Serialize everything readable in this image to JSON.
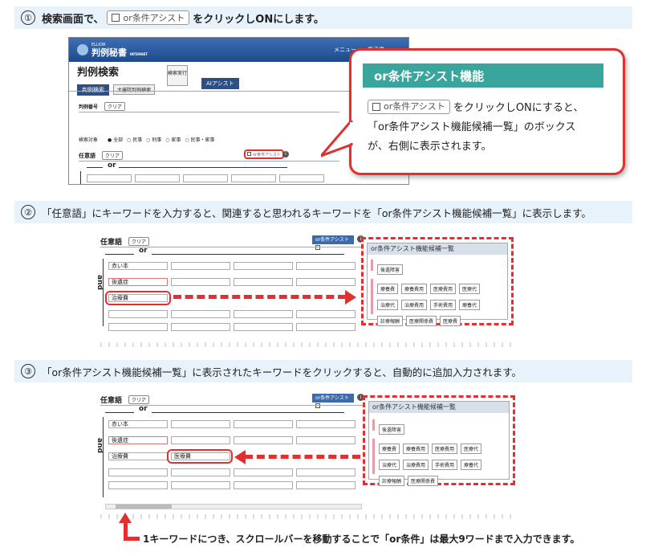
{
  "step1": {
    "num": "①",
    "pre": "検索画面で、",
    "btn": "or条件アシスト",
    "post": "をクリックしONにします。"
  },
  "app1": {
    "logo_small": "ELLIOR",
    "logo": "判例秘書",
    "logo_sub": "INTERNET",
    "menu": "メニュー",
    "menu2": "電子書",
    "page_title": "判例検索",
    "tab1": "判例検索",
    "tab2": "大審院判例検索",
    "search_btn": "検索実行",
    "ai_btn": "AIアシスト",
    "case_no_label": "判例番号",
    "clear": "クリア",
    "target_label": "検索対象",
    "targets": [
      "全部",
      "民事",
      "刑事",
      "家事",
      "民事・家事"
    ],
    "keyword_label": "任意語",
    "or_assist": "or条件アシスト",
    "or_label": "or"
  },
  "callout": {
    "title": "or条件アシスト機能",
    "btn": "or条件アシスト",
    "line1": "をクリックしONにすると、",
    "line2": "「or条件アシスト機能候補一覧」のボックス",
    "line3": "が、右側に表示されます。"
  },
  "step2": {
    "num": "②",
    "text": "「任意語」にキーワードを入力すると、関連すると思われるキーワードを「or条件アシスト機能候補一覧」に表示します。"
  },
  "step3": {
    "num": "③",
    "text": "「or条件アシスト機能候補一覧」に表示されたキーワードをクリックすると、自動的に追加入力されます。"
  },
  "shot": {
    "keyword_label": "任意語",
    "clear": "クリア",
    "or_assist": "or条件アシスト",
    "or_label": "or",
    "and_label": "and",
    "row1": "赤い本",
    "row2": "後遺症",
    "row3": "治療費",
    "added": "医療費",
    "panel_title": "or条件アシスト機能候補一覧",
    "top_kw": "後遺障害",
    "keywords": [
      "療養費",
      "診療報酬",
      "医療費用",
      "医療代",
      "治療代",
      "治療費用",
      "手術費用",
      "療養代",
      "診療報酬",
      "医療関係費",
      "医療費"
    ],
    "keywords_row3": [
      "療養費",
      "療養費用",
      "医療費用",
      "医療代",
      "治療代",
      "治療費用",
      "手術費用",
      "療養代",
      "診療報酬",
      "医療関係費"
    ]
  },
  "note": "1キーワードにつき、スクロールバーを移動することで「or条件」は最大9ワードまで入力できます。"
}
